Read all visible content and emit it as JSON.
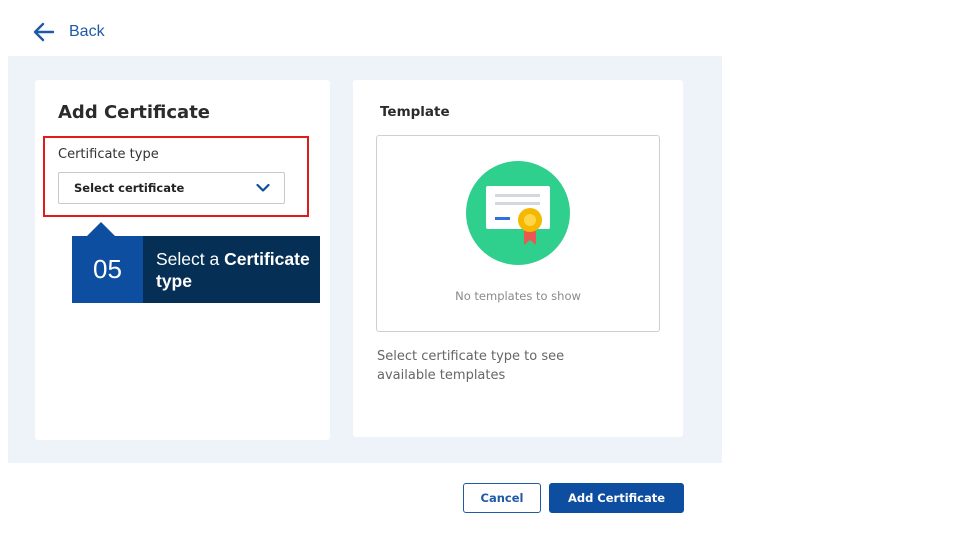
{
  "header": {
    "back_label": "Back"
  },
  "form": {
    "title": "Add Certificate",
    "certificate_type_label": "Certificate type",
    "certificate_select_value": "Select certificate"
  },
  "tutorial": {
    "step_number": "05",
    "text_prefix": "Select a ",
    "text_bold": "Certificate type",
    "highlight_color": "#e01b1b"
  },
  "template": {
    "title": "Template",
    "empty_text": "No templates to show",
    "help_text": "Select certificate type to see available templates"
  },
  "footer": {
    "cancel_label": "Cancel",
    "add_label": "Add Certificate"
  },
  "colors": {
    "accent": "#0d4ea0",
    "panel_bg": "#edf3f9",
    "illustration": "#2fcf8e"
  }
}
